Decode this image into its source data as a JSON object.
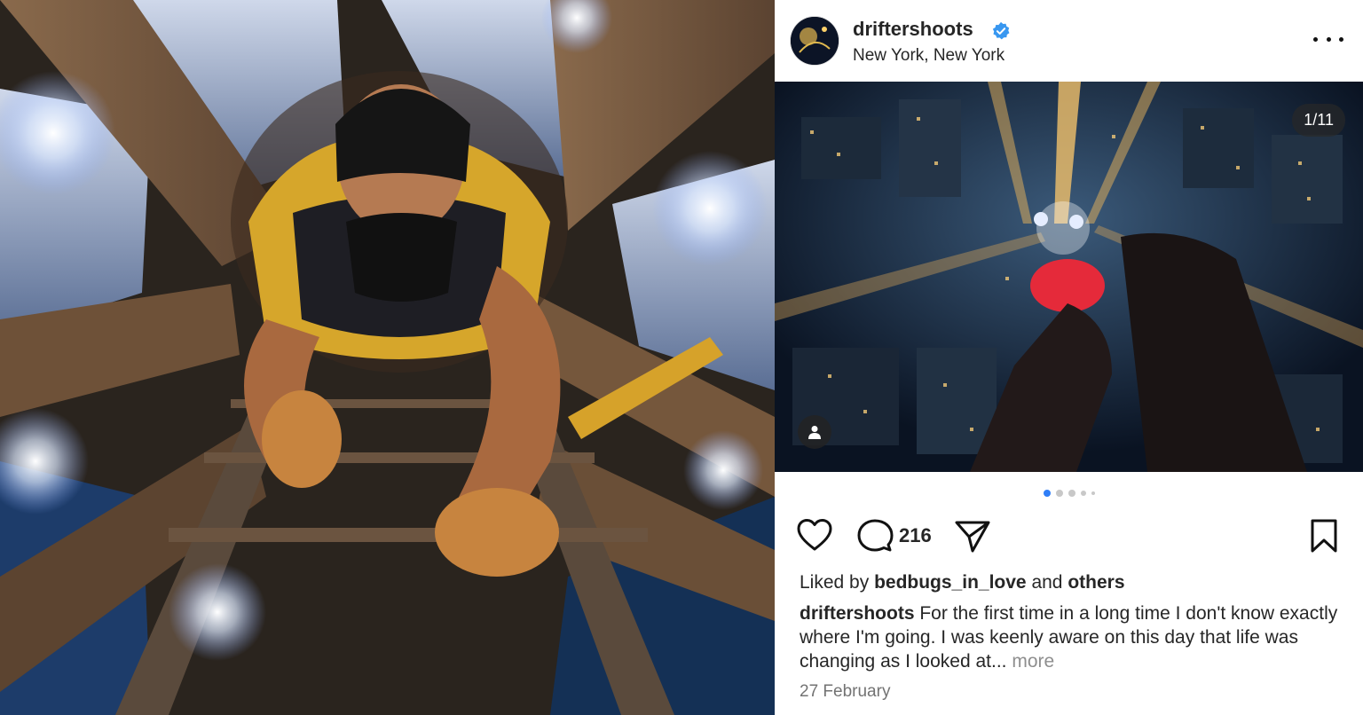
{
  "post": {
    "username": "driftershoots",
    "location": "New York, New York",
    "counter": "1/11",
    "comment_count": "216",
    "liked_by_prefix": "Liked by",
    "liked_by_user": "bedbugs_in_love",
    "liked_by_and": "and",
    "liked_by_others": "others",
    "caption_user": "driftershoots",
    "caption_text": "For the first time in a long time I don't know exactly where I'm going. I was keenly aware on this day that life was changing as I looked at...",
    "caption_more": "more",
    "date": "27 February"
  },
  "icons": {
    "verified": "verified-badge-icon",
    "more": "more-options-icon",
    "tag": "tagged-user-icon",
    "like": "heart-icon",
    "comment": "comment-icon",
    "share": "share-icon",
    "save": "bookmark-icon"
  },
  "colors": {
    "verified_blue": "#3897f0",
    "active_dot": "#2f7ef7",
    "text": "#262626",
    "muted": "#8e8e8e"
  }
}
